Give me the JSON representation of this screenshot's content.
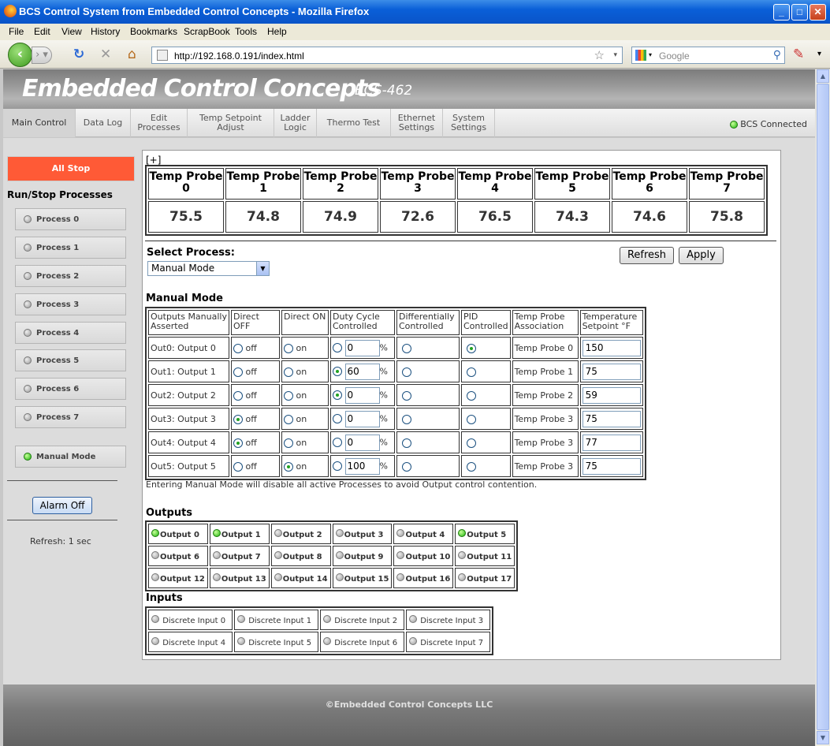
{
  "window": {
    "title": "BCS Control System from Embedded Control Concepts - Mozilla Firefox"
  },
  "menu": [
    "File",
    "Edit",
    "View",
    "History",
    "Bookmarks",
    "ScrapBook",
    "Tools",
    "Help"
  ],
  "nav": {
    "url": "http://192.168.0.191/index.html",
    "search_placeholder": "Google"
  },
  "header": {
    "brand": "Embedded Control Concepts",
    "model": "BCS-462"
  },
  "tabs": [
    {
      "label": "Main Control",
      "active": true
    },
    {
      "label": "Data Log"
    },
    {
      "label": "Edit\nProcesses"
    },
    {
      "label": "Temp Setpoint\nAdjust"
    },
    {
      "label": "Ladder\nLogic"
    },
    {
      "label": "Thermo Test"
    },
    {
      "label": "Ethernet\nSettings"
    },
    {
      "label": "System\nSettings"
    }
  ],
  "status": {
    "connected": "BCS Connected"
  },
  "sidebar": {
    "all_stop": "All Stop",
    "heading": "Run/Stop Processes",
    "processes": [
      "Process 0",
      "Process 1",
      "Process 2",
      "Process 3",
      "Process 4",
      "Process 5",
      "Process 6",
      "Process 7"
    ],
    "manual_mode": "Manual Mode",
    "alarm_off": "Alarm Off",
    "refresh": "Refresh: 1 sec"
  },
  "panel": {
    "expand": "[+]",
    "probes": [
      {
        "label": "Temp Probe",
        "num": "0",
        "value": "75.5"
      },
      {
        "label": "Temp Probe",
        "num": "1",
        "value": "74.8"
      },
      {
        "label": "Temp Probe",
        "num": "2",
        "value": "74.9"
      },
      {
        "label": "Temp Probe",
        "num": "3",
        "value": "72.6"
      },
      {
        "label": "Temp Probe",
        "num": "4",
        "value": "76.5"
      },
      {
        "label": "Temp Probe",
        "num": "5",
        "value": "74.3"
      },
      {
        "label": "Temp Probe",
        "num": "6",
        "value": "74.6"
      },
      {
        "label": "Temp Probe",
        "num": "7",
        "value": "75.8"
      }
    ],
    "select_process_label": "Select Process:",
    "select_process_value": "Manual Mode",
    "refresh_btn": "Refresh",
    "apply_btn": "Apply",
    "manual_heading": "Manual Mode",
    "manual_headers": [
      "Outputs Manually Asserted",
      "Direct OFF",
      "Direct ON",
      "Duty Cycle Controlled",
      "Differentially Controlled",
      "PID Controlled",
      "Temp Probe Association",
      "Temperature Setpoint °F"
    ],
    "off_label": "off",
    "on_label": "on",
    "pct": "%",
    "manual_rows": [
      {
        "name": "Out0: Output 0",
        "mode": "pid",
        "duty": "0",
        "probe": "Temp Probe 0",
        "setpoint": "150"
      },
      {
        "name": "Out1: Output 1",
        "mode": "duty",
        "duty": "60",
        "probe": "Temp Probe 1",
        "setpoint": "75"
      },
      {
        "name": "Out2: Output 2",
        "mode": "duty",
        "duty": "0",
        "probe": "Temp Probe 2",
        "setpoint": "59"
      },
      {
        "name": "Out3: Output 3",
        "mode": "off",
        "duty": "0",
        "probe": "Temp Probe 3",
        "setpoint": "75"
      },
      {
        "name": "Out4: Output 4",
        "mode": "off",
        "duty": "0",
        "probe": "Temp Probe 3",
        "setpoint": "77"
      },
      {
        "name": "Out5: Output 5",
        "mode": "on",
        "duty": "100",
        "probe": "Temp Probe 3",
        "setpoint": "75"
      }
    ],
    "note": "Entering Manual Mode will disable all active Processes to avoid Output control contention.",
    "outputs_heading": "Outputs",
    "outputs": [
      {
        "label": "Output 0",
        "on": true
      },
      {
        "label": "Output 1",
        "on": true
      },
      {
        "label": "Output 2",
        "on": false
      },
      {
        "label": "Output 3",
        "on": false
      },
      {
        "label": "Output 4",
        "on": false
      },
      {
        "label": "Output 5",
        "on": true
      },
      {
        "label": "Output 6",
        "on": false
      },
      {
        "label": "Output 7",
        "on": false
      },
      {
        "label": "Output 8",
        "on": false
      },
      {
        "label": "Output 9",
        "on": false
      },
      {
        "label": "Output 10",
        "on": false
      },
      {
        "label": "Output 11",
        "on": false
      },
      {
        "label": "Output 12",
        "on": false
      },
      {
        "label": "Output 13",
        "on": false
      },
      {
        "label": "Output 14",
        "on": false
      },
      {
        "label": "Output 15",
        "on": false
      },
      {
        "label": "Output 16",
        "on": false
      },
      {
        "label": "Output 17",
        "on": false
      }
    ],
    "inputs_heading": "Inputs",
    "inputs": [
      "Discrete Input 0",
      "Discrete Input 1",
      "Discrete Input 2",
      "Discrete Input 3",
      "Discrete Input 4",
      "Discrete Input 5",
      "Discrete Input 6",
      "Discrete Input 7"
    ]
  },
  "footer": {
    "copyright": "©Embedded Control Concepts LLC"
  },
  "colors": {
    "all_stop": "#ff5a36",
    "led_on": "#1fb50d",
    "titlebar": "#0a5fd8"
  }
}
